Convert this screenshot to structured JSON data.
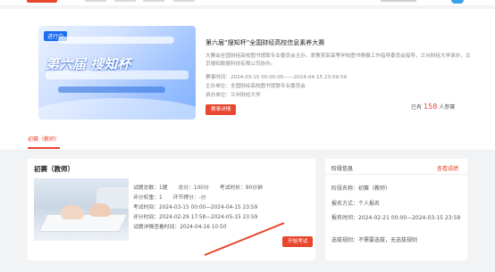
{
  "banner": {
    "tag": "进行中",
    "headline": "第六届 搜知杯"
  },
  "competition": {
    "title": "第六届“搜知杯”全国财经高校信息素养大赛",
    "description": "大赛由全国财经高校图书馆联专业委员会主办，爱教育部高等学校图书情报工作指导委员会指导，兰州财经大学承办，北京搜知数据科技有限公司协办。",
    "time_label": "赛事时间：",
    "time_value": "2024-03-15 00:00:00——2024-04-15 23:59:59",
    "organizer_label": "主办单位：",
    "organizer_value": "全国财经高校图书馆联专业委员会",
    "host_label": "承办单位：",
    "host_value": "兰州财经大学",
    "detail_button": "赛事详情",
    "participants_prefix": "已有",
    "participants_count": "158",
    "participants_suffix": "人参赛"
  },
  "tabs": {
    "active": "初赛（教师）"
  },
  "stage": {
    "title": "初赛（教师）",
    "question_count_label": "试题总数：",
    "question_count": "1题",
    "total_score_label": "总分：",
    "total_score": "100分",
    "duration_label": "考试时长：",
    "duration": "90分钟",
    "weight_label": "评分权重：",
    "weight": "1",
    "round_score_label": "环节得分：",
    "round_score": "-分",
    "exam_time_label": "考试时间：",
    "exam_time": "2024-03-15 00:00—2024-04-15 23:59",
    "grading_time_label": "评分时间：",
    "grading_time": "2024-02-29 17:58—2024-05-15 23:59",
    "review_time_label": "试题详情查看时间：",
    "review_time": "2024-04-16 10:50",
    "start_button": "开始考试"
  },
  "stage_info": {
    "title": "阶段信息",
    "view_results": "查看成绩",
    "name_label": "阶段名称：",
    "name_value": "初赛（教师）",
    "signup_method_label": "报名方式：",
    "signup_method_value": "个人报名",
    "signup_time_label": "报名时间：",
    "signup_time_value": "2024-02-21 00:00—2024-03-15 23:59",
    "promotion_label": "选拔规则：",
    "promotion_value": "不需要选拔，无选拔规则"
  },
  "colors": {
    "accent": "#e8472f",
    "banner_blue": "#1b6cf0"
  }
}
